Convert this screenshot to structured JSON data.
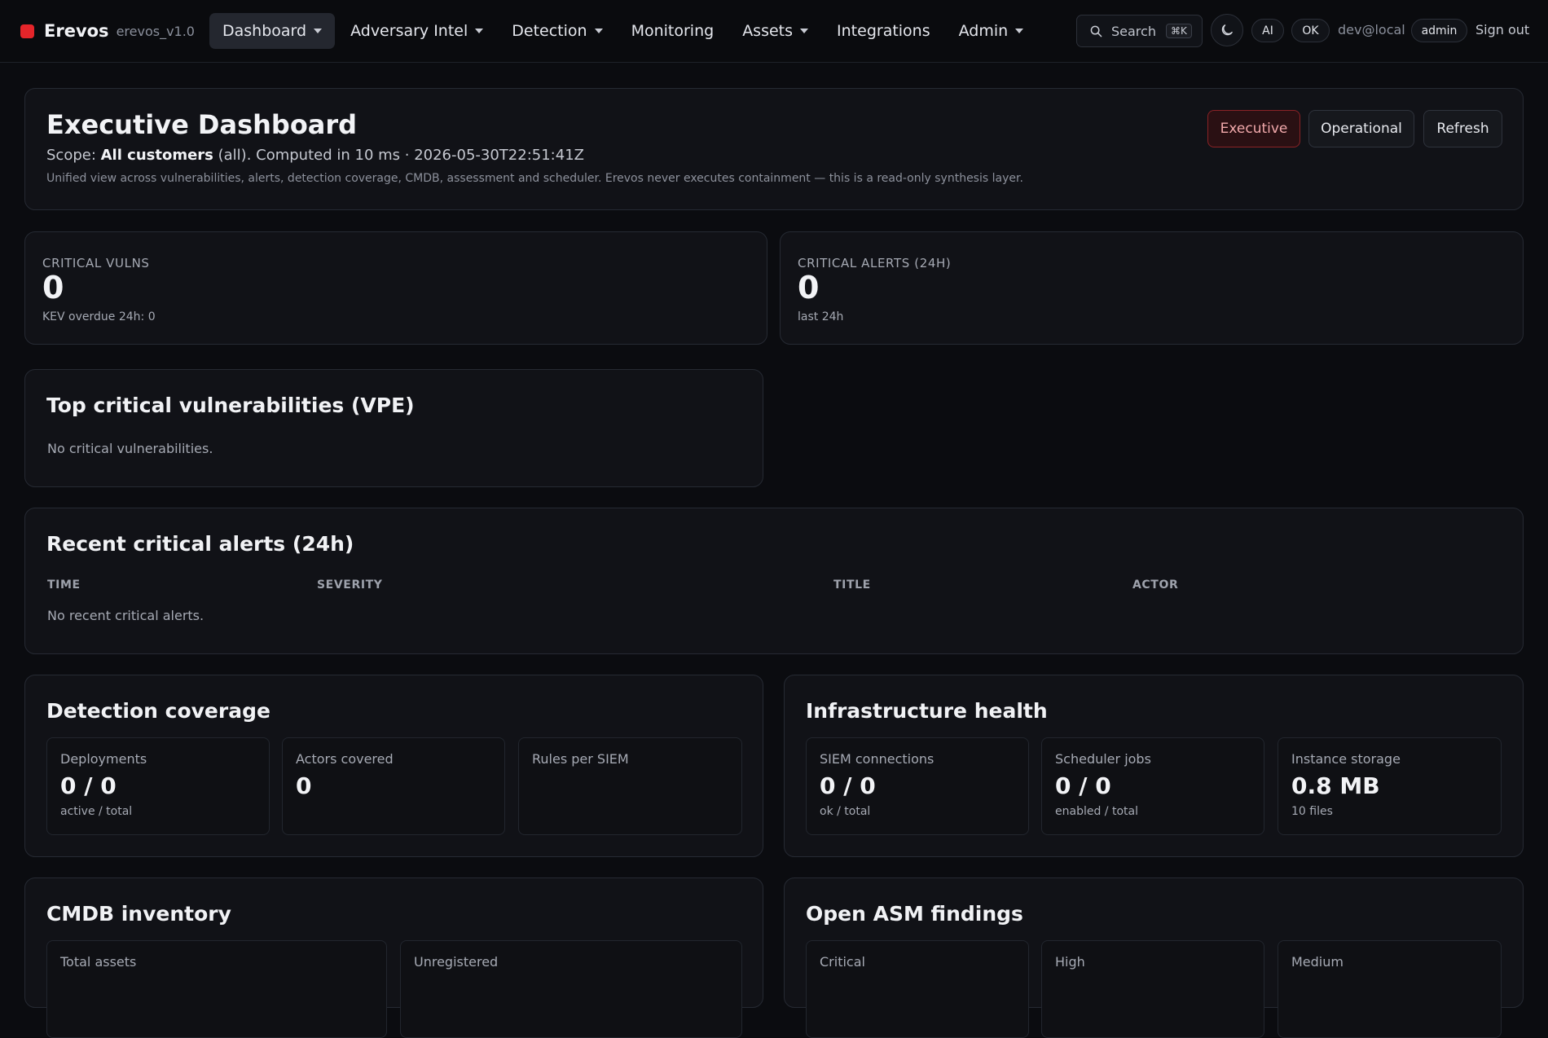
{
  "brand": {
    "name": "Erevos",
    "version": "erevos_v1.0"
  },
  "nav": [
    {
      "label": "Dashboard",
      "dropdown": true,
      "active": true
    },
    {
      "label": "Adversary Intel",
      "dropdown": true
    },
    {
      "label": "Detection",
      "dropdown": true
    },
    {
      "label": "Monitoring",
      "dropdown": false
    },
    {
      "label": "Assets",
      "dropdown": true
    },
    {
      "label": "Integrations",
      "dropdown": false
    },
    {
      "label": "Admin",
      "dropdown": true
    }
  ],
  "toolbar": {
    "search_label": "Search",
    "search_shortcut": "⌘K",
    "ai_label": "AI",
    "status_label": "OK",
    "user": "dev@local",
    "role": "admin",
    "signout": "Sign out"
  },
  "header": {
    "title": "Executive Dashboard",
    "scope_prefix": "Scope: ",
    "scope_value": "All customers",
    "scope_suffix": " (all). Computed in 10 ms · 2026-05-30T22:51:41Z",
    "note": "Unified view across vulnerabilities, alerts, detection coverage, CMDB, assessment and scheduler. Erevos never executes containment — this is a read-only synthesis layer.",
    "buttons": {
      "executive": "Executive",
      "operational": "Operational",
      "refresh": "Refresh"
    }
  },
  "kpis": {
    "vulns": {
      "label": "CRITICAL VULNS",
      "value": "0",
      "sub": "KEV overdue 24h: 0"
    },
    "alerts": {
      "label": "CRITICAL ALERTS (24H)",
      "value": "0",
      "sub": "last 24h"
    }
  },
  "top_vulns": {
    "title": "Top critical vulnerabilities (VPE)",
    "empty": "No critical vulnerabilities."
  },
  "recent_alerts": {
    "title": "Recent critical alerts (24h)",
    "columns": [
      "TIME",
      "SEVERITY",
      "TITLE",
      "ACTOR"
    ],
    "empty": "No recent critical alerts."
  },
  "detection": {
    "title": "Detection coverage",
    "stats": [
      {
        "label": "Deployments",
        "value": "0 / 0",
        "sub": "active / total"
      },
      {
        "label": "Actors covered",
        "value": "0",
        "sub": ""
      },
      {
        "label": "Rules per SIEM",
        "value": "",
        "sub": ""
      }
    ]
  },
  "infra": {
    "title": "Infrastructure health",
    "stats": [
      {
        "label": "SIEM connections",
        "value": "0 / 0",
        "sub": "ok / total"
      },
      {
        "label": "Scheduler jobs",
        "value": "0 / 0",
        "sub": "enabled / total"
      },
      {
        "label": "Instance storage",
        "value": "0.8 MB",
        "sub": "10 files"
      }
    ]
  },
  "cmdb": {
    "title": "CMDB inventory",
    "stats": [
      {
        "label": "Total assets"
      },
      {
        "label": "Unregistered"
      }
    ]
  },
  "asm": {
    "title": "Open ASM findings",
    "stats": [
      {
        "label": "Critical"
      },
      {
        "label": "High"
      },
      {
        "label": "Medium"
      }
    ]
  }
}
